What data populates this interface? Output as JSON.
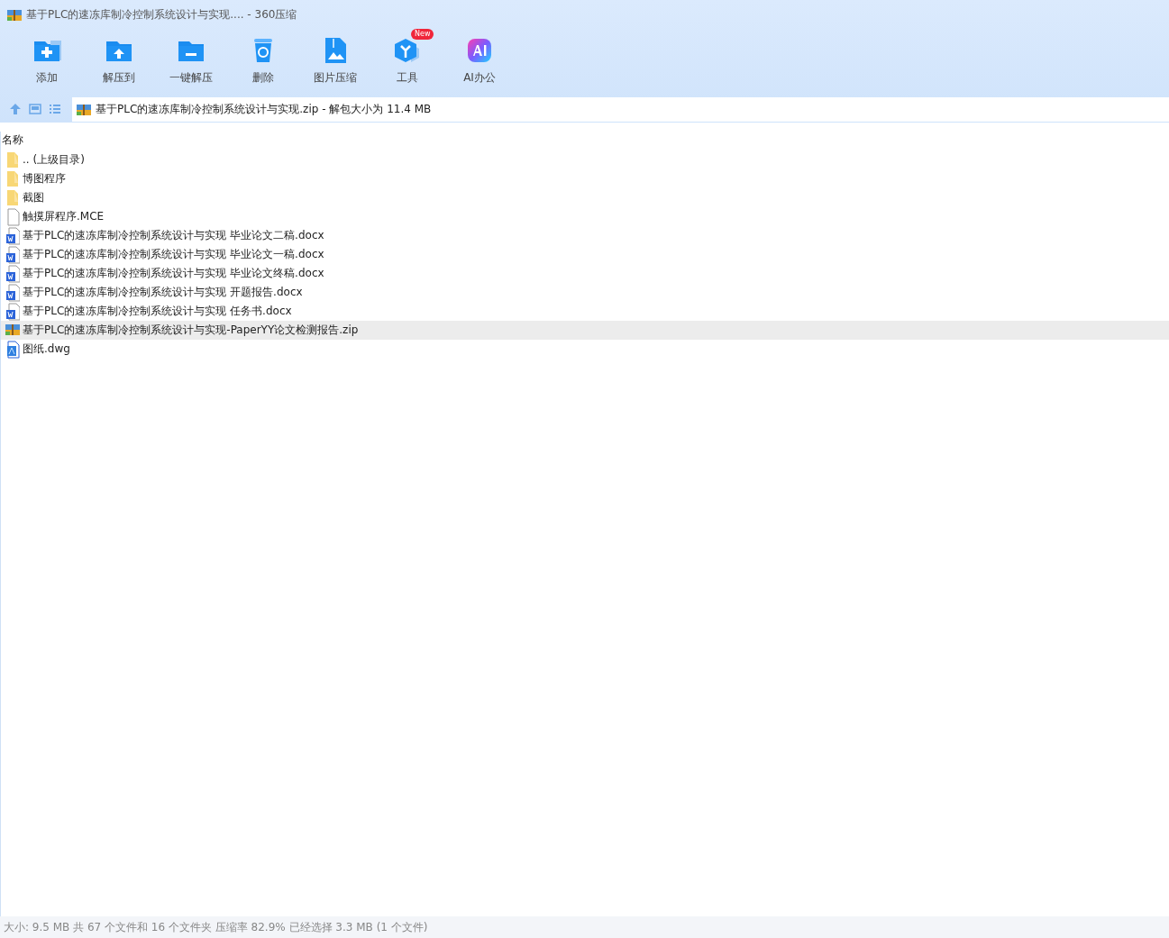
{
  "window": {
    "title": "基于PLC的速冻库制冷控制系统设计与实现.... - 360压缩"
  },
  "toolbar": [
    {
      "kind": "add",
      "label": "添加"
    },
    {
      "kind": "extract",
      "label": "解压到"
    },
    {
      "kind": "quick",
      "label": "一键解压"
    },
    {
      "kind": "delete",
      "label": "删除"
    },
    {
      "kind": "image",
      "label": "图片压缩"
    },
    {
      "kind": "tools",
      "label": "工具",
      "badge": "New"
    },
    {
      "kind": "ai",
      "label": "AI办公"
    }
  ],
  "address": {
    "path": "基于PLC的速冻库制冷控制系统设计与实现.zip - 解包大小为 11.4 MB"
  },
  "table": {
    "columns": [
      "名称"
    ],
    "rows": [
      {
        "kind": "folder",
        "name": ".. (上级目录)",
        "selected": false
      },
      {
        "kind": "folder",
        "name": "博图程序",
        "selected": false
      },
      {
        "kind": "folder",
        "name": "截图",
        "selected": false
      },
      {
        "kind": "file",
        "name": "触摸屏程序.MCE",
        "selected": false
      },
      {
        "kind": "word",
        "name": "基于PLC的速冻库制冷控制系统设计与实现 毕业论文二稿.docx",
        "selected": false
      },
      {
        "kind": "word",
        "name": "基于PLC的速冻库制冷控制系统设计与实现 毕业论文一稿.docx",
        "selected": false
      },
      {
        "kind": "word",
        "name": "基于PLC的速冻库制冷控制系统设计与实现 毕业论文终稿.docx",
        "selected": false
      },
      {
        "kind": "word",
        "name": "基于PLC的速冻库制冷控制系统设计与实现 开题报告.docx",
        "selected": false
      },
      {
        "kind": "word",
        "name": "基于PLC的速冻库制冷控制系统设计与实现 任务书.docx",
        "selected": false
      },
      {
        "kind": "zip",
        "name": "基于PLC的速冻库制冷控制系统设计与实现-PaperYY论文检测报告.zip",
        "selected": true
      },
      {
        "kind": "dwg",
        "name": "图纸.dwg",
        "selected": false
      }
    ]
  },
  "status_bar": "大小: 9.5 MB 共 67 个文件和 16 个文件夹 压缩率 82.9% 已经选择 3.3 MB (1 个文件)"
}
